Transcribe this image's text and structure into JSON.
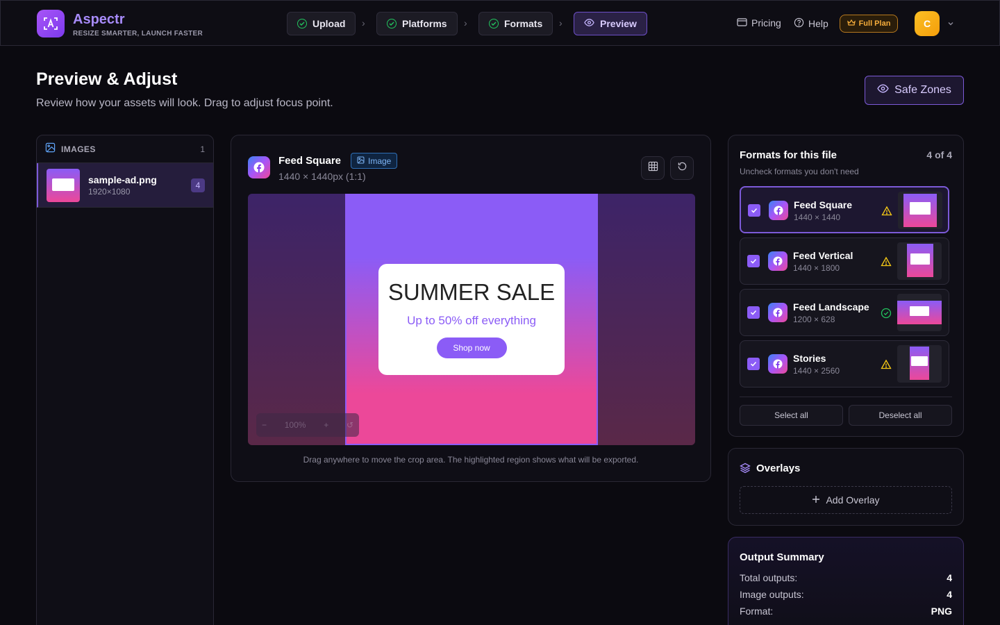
{
  "app": {
    "brand": "Aspectr",
    "tagline": "RESIZE SMARTER, LAUNCH FASTER"
  },
  "steps": [
    {
      "label": "Upload",
      "state": "done"
    },
    {
      "label": "Platforms",
      "state": "done"
    },
    {
      "label": "Formats",
      "state": "done"
    },
    {
      "label": "Preview",
      "state": "active"
    }
  ],
  "nav": {
    "pricing": "Pricing",
    "help": "Help",
    "plan": "Full Plan",
    "avatar_initial": "C"
  },
  "page": {
    "title": "Preview & Adjust",
    "subtitle": "Review how your assets will look. Drag to adjust focus point.",
    "safe_zones": "Safe Zones"
  },
  "images_panel": {
    "title": "IMAGES",
    "count": "1",
    "files": [
      {
        "name": "sample-ad.png",
        "dimensions": "1920×1080",
        "badge": "4"
      }
    ]
  },
  "preview": {
    "format_name": "Feed Square",
    "type_tag": "Image",
    "size": "1440 × 1440px (1:1)",
    "ad": {
      "title": "SUMMER SALE",
      "subtitle": "Up to 50% off everything",
      "cta": "Shop now"
    },
    "zoom": "100%",
    "hint": "Drag anywhere to move the crop area. The highlighted region shows what will be exported."
  },
  "formats_panel": {
    "title": "Formats for this file",
    "count": "4 of 4",
    "subtitle": "Uncheck formats you don't need",
    "items": [
      {
        "name": "Feed Square",
        "dimensions": "1440 × 1440",
        "status": "warning",
        "checked": true
      },
      {
        "name": "Feed Vertical",
        "dimensions": "1440 × 1800",
        "status": "warning",
        "checked": true
      },
      {
        "name": "Feed Landscape",
        "dimensions": "1200 × 628",
        "status": "ok",
        "checked": true
      },
      {
        "name": "Stories",
        "dimensions": "1440 × 2560",
        "status": "warning",
        "checked": true
      }
    ],
    "select_all": "Select all",
    "deselect_all": "Deselect all"
  },
  "overlays": {
    "title": "Overlays",
    "add": "Add Overlay"
  },
  "summary": {
    "title": "Output Summary",
    "rows": [
      {
        "label": "Total outputs:",
        "value": "4"
      },
      {
        "label": "Image outputs:",
        "value": "4"
      },
      {
        "label": "Format:",
        "value": "PNG"
      }
    ]
  },
  "colors": {
    "accent": "#8b5cf6",
    "warning": "#facc15",
    "success": "#22c55e",
    "plan": "#f6ad3b"
  }
}
